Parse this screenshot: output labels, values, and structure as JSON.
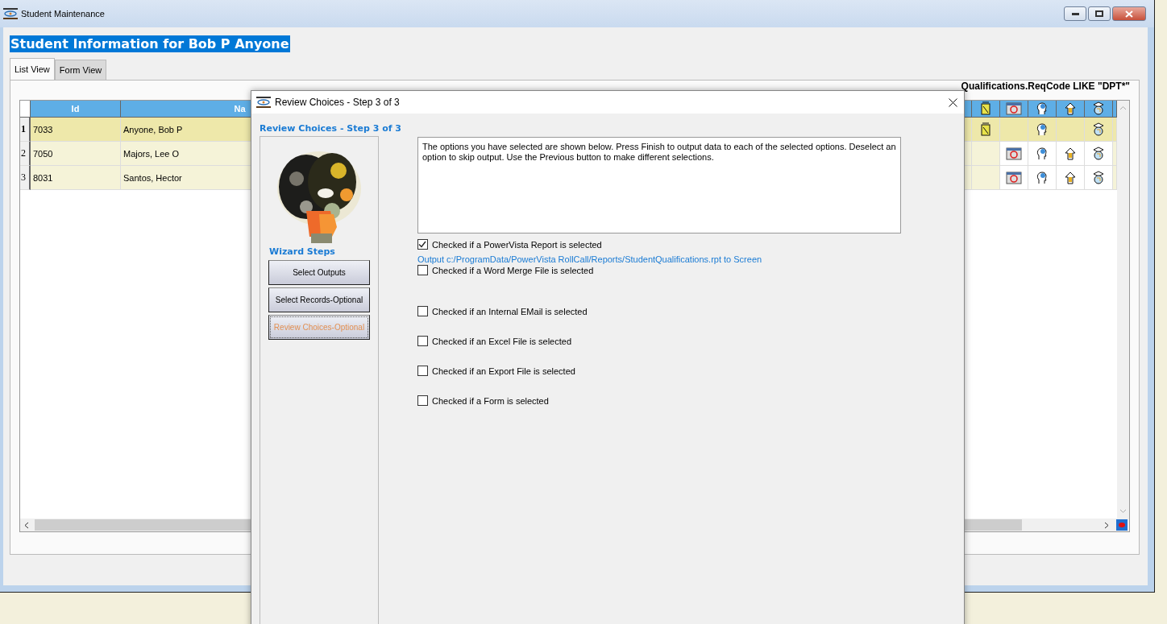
{
  "window": {
    "title": "Student Maintenance"
  },
  "heading": "Student Information  for Bob P Anyone",
  "tabs": [
    {
      "label": "List View",
      "selected": true
    },
    {
      "label": "Form View",
      "selected": false
    }
  ],
  "search_text": "Qualifications.ReqCode  LIKE  \"DPT*\"",
  "table": {
    "columns": [
      "Id",
      "Na"
    ],
    "rows": [
      {
        "number": "1",
        "id": "7033",
        "name": "Anyone, Bob P",
        "selected": true,
        "icons_shown": [
          true,
          false,
          true,
          false,
          true
        ]
      },
      {
        "number": "2",
        "id": "7050",
        "name": "Majors, Lee O",
        "selected": false,
        "icons_shown": [
          false,
          true,
          true,
          true,
          true
        ]
      },
      {
        "number": "3",
        "id": "8031",
        "name": "Santos, Hector",
        "selected": false,
        "icons_shown": [
          false,
          true,
          true,
          true,
          true
        ]
      }
    ]
  },
  "dialog": {
    "title": "Review Choices - Step 3 of 3",
    "heading": "Review Choices - Step 3 of 3",
    "steps_label": "Wizard Steps",
    "steps": [
      {
        "label": "Select Outputs",
        "selected": false
      },
      {
        "label": "Select Records-Optional",
        "selected": false
      },
      {
        "label": "Review Choices-Optional",
        "selected": true
      }
    ],
    "message": "The options you have selected are shown below. Press Finish to output data to each of the selected options. Deselect an option to skip output. Use the Previous button to make different selections.",
    "options": [
      {
        "label": "Checked if a PowerVista Report is selected",
        "checked": true,
        "output": "Output c:/ProgramData/PowerVista RollCall/Reports/StudentQualifications.rpt to Screen"
      },
      {
        "label": "Checked if a Word Merge File is selected",
        "checked": false
      },
      {
        "label": "Checked if an Internal EMail is selected",
        "checked": false
      },
      {
        "label": "Checked if an Excel File is selected",
        "checked": false
      },
      {
        "label": "Checked if an Export File is selected",
        "checked": false
      },
      {
        "label": "Checked if a Form is selected",
        "checked": false
      }
    ]
  }
}
